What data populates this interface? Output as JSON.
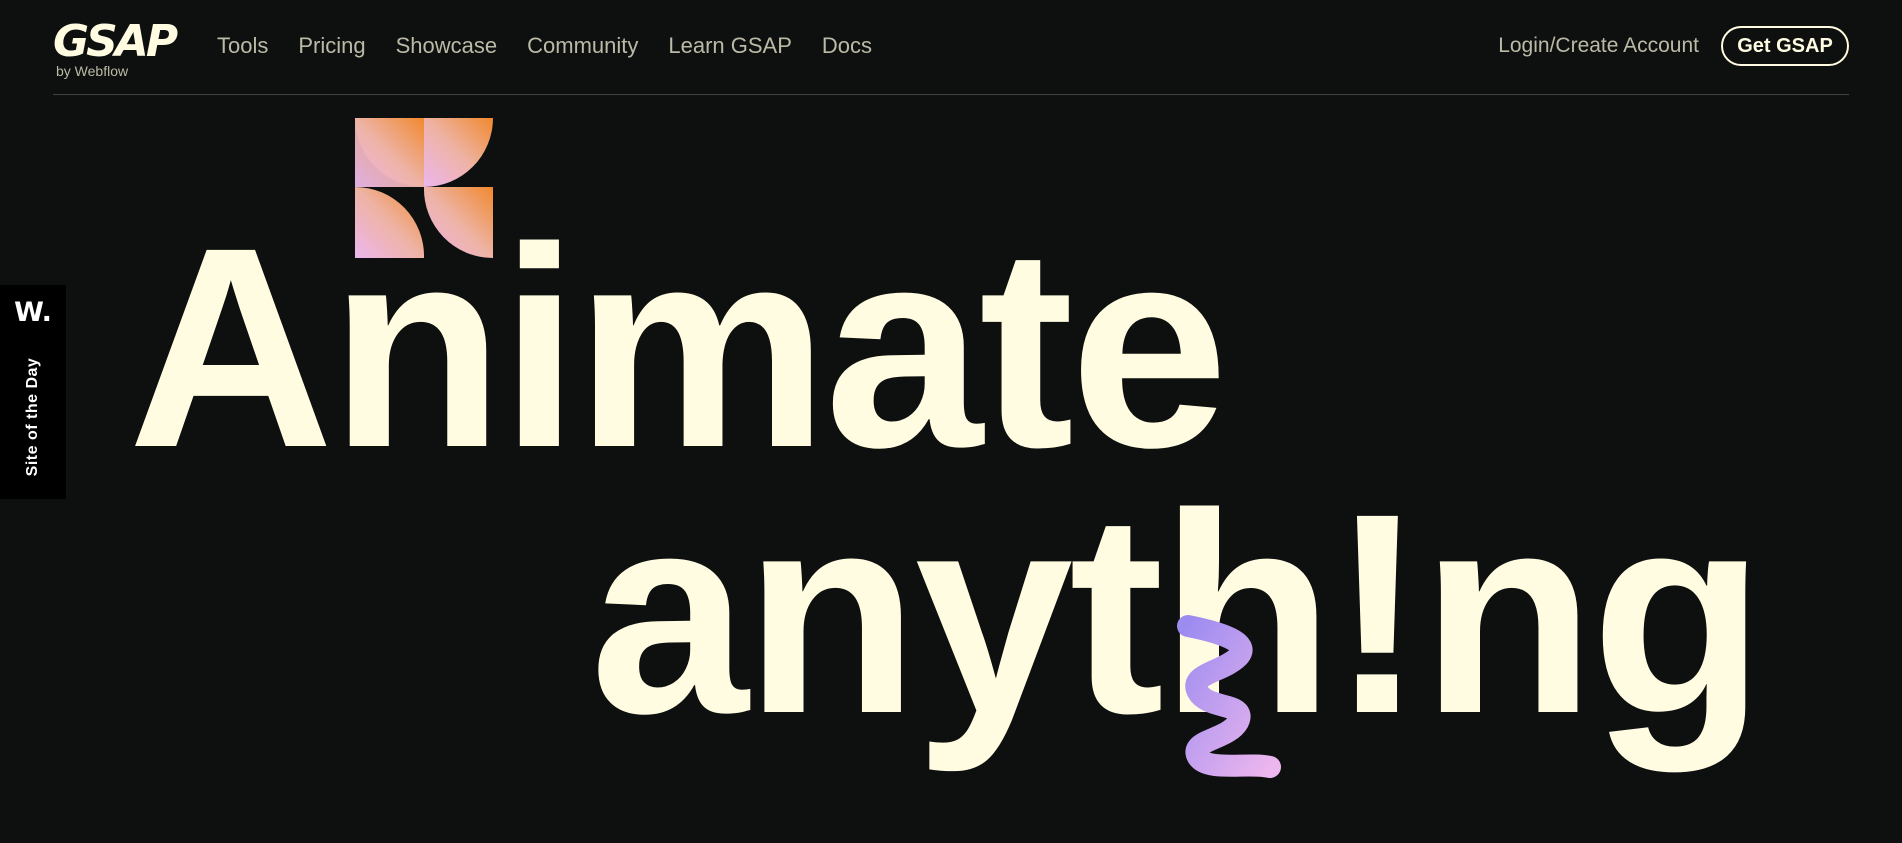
{
  "brand": {
    "logo": "GSAP",
    "sub": "by Webflow"
  },
  "nav": {
    "links": [
      "Tools",
      "Pricing",
      "Showcase",
      "Community",
      "Learn GSAP",
      "Docs"
    ],
    "login": "Login/Create Account",
    "cta": "Get GSAP"
  },
  "badge": {
    "mark": "W.",
    "label": "Site of the Day"
  },
  "hero": {
    "line1": "Animate",
    "line2": "anyth!ng"
  },
  "colors": {
    "background": "#0e100f",
    "text": "#fffce1",
    "muted": "#bbbaa6",
    "orange": "#f0892e",
    "pink": "#ecb6ee",
    "purple": "#9d8cf0"
  }
}
